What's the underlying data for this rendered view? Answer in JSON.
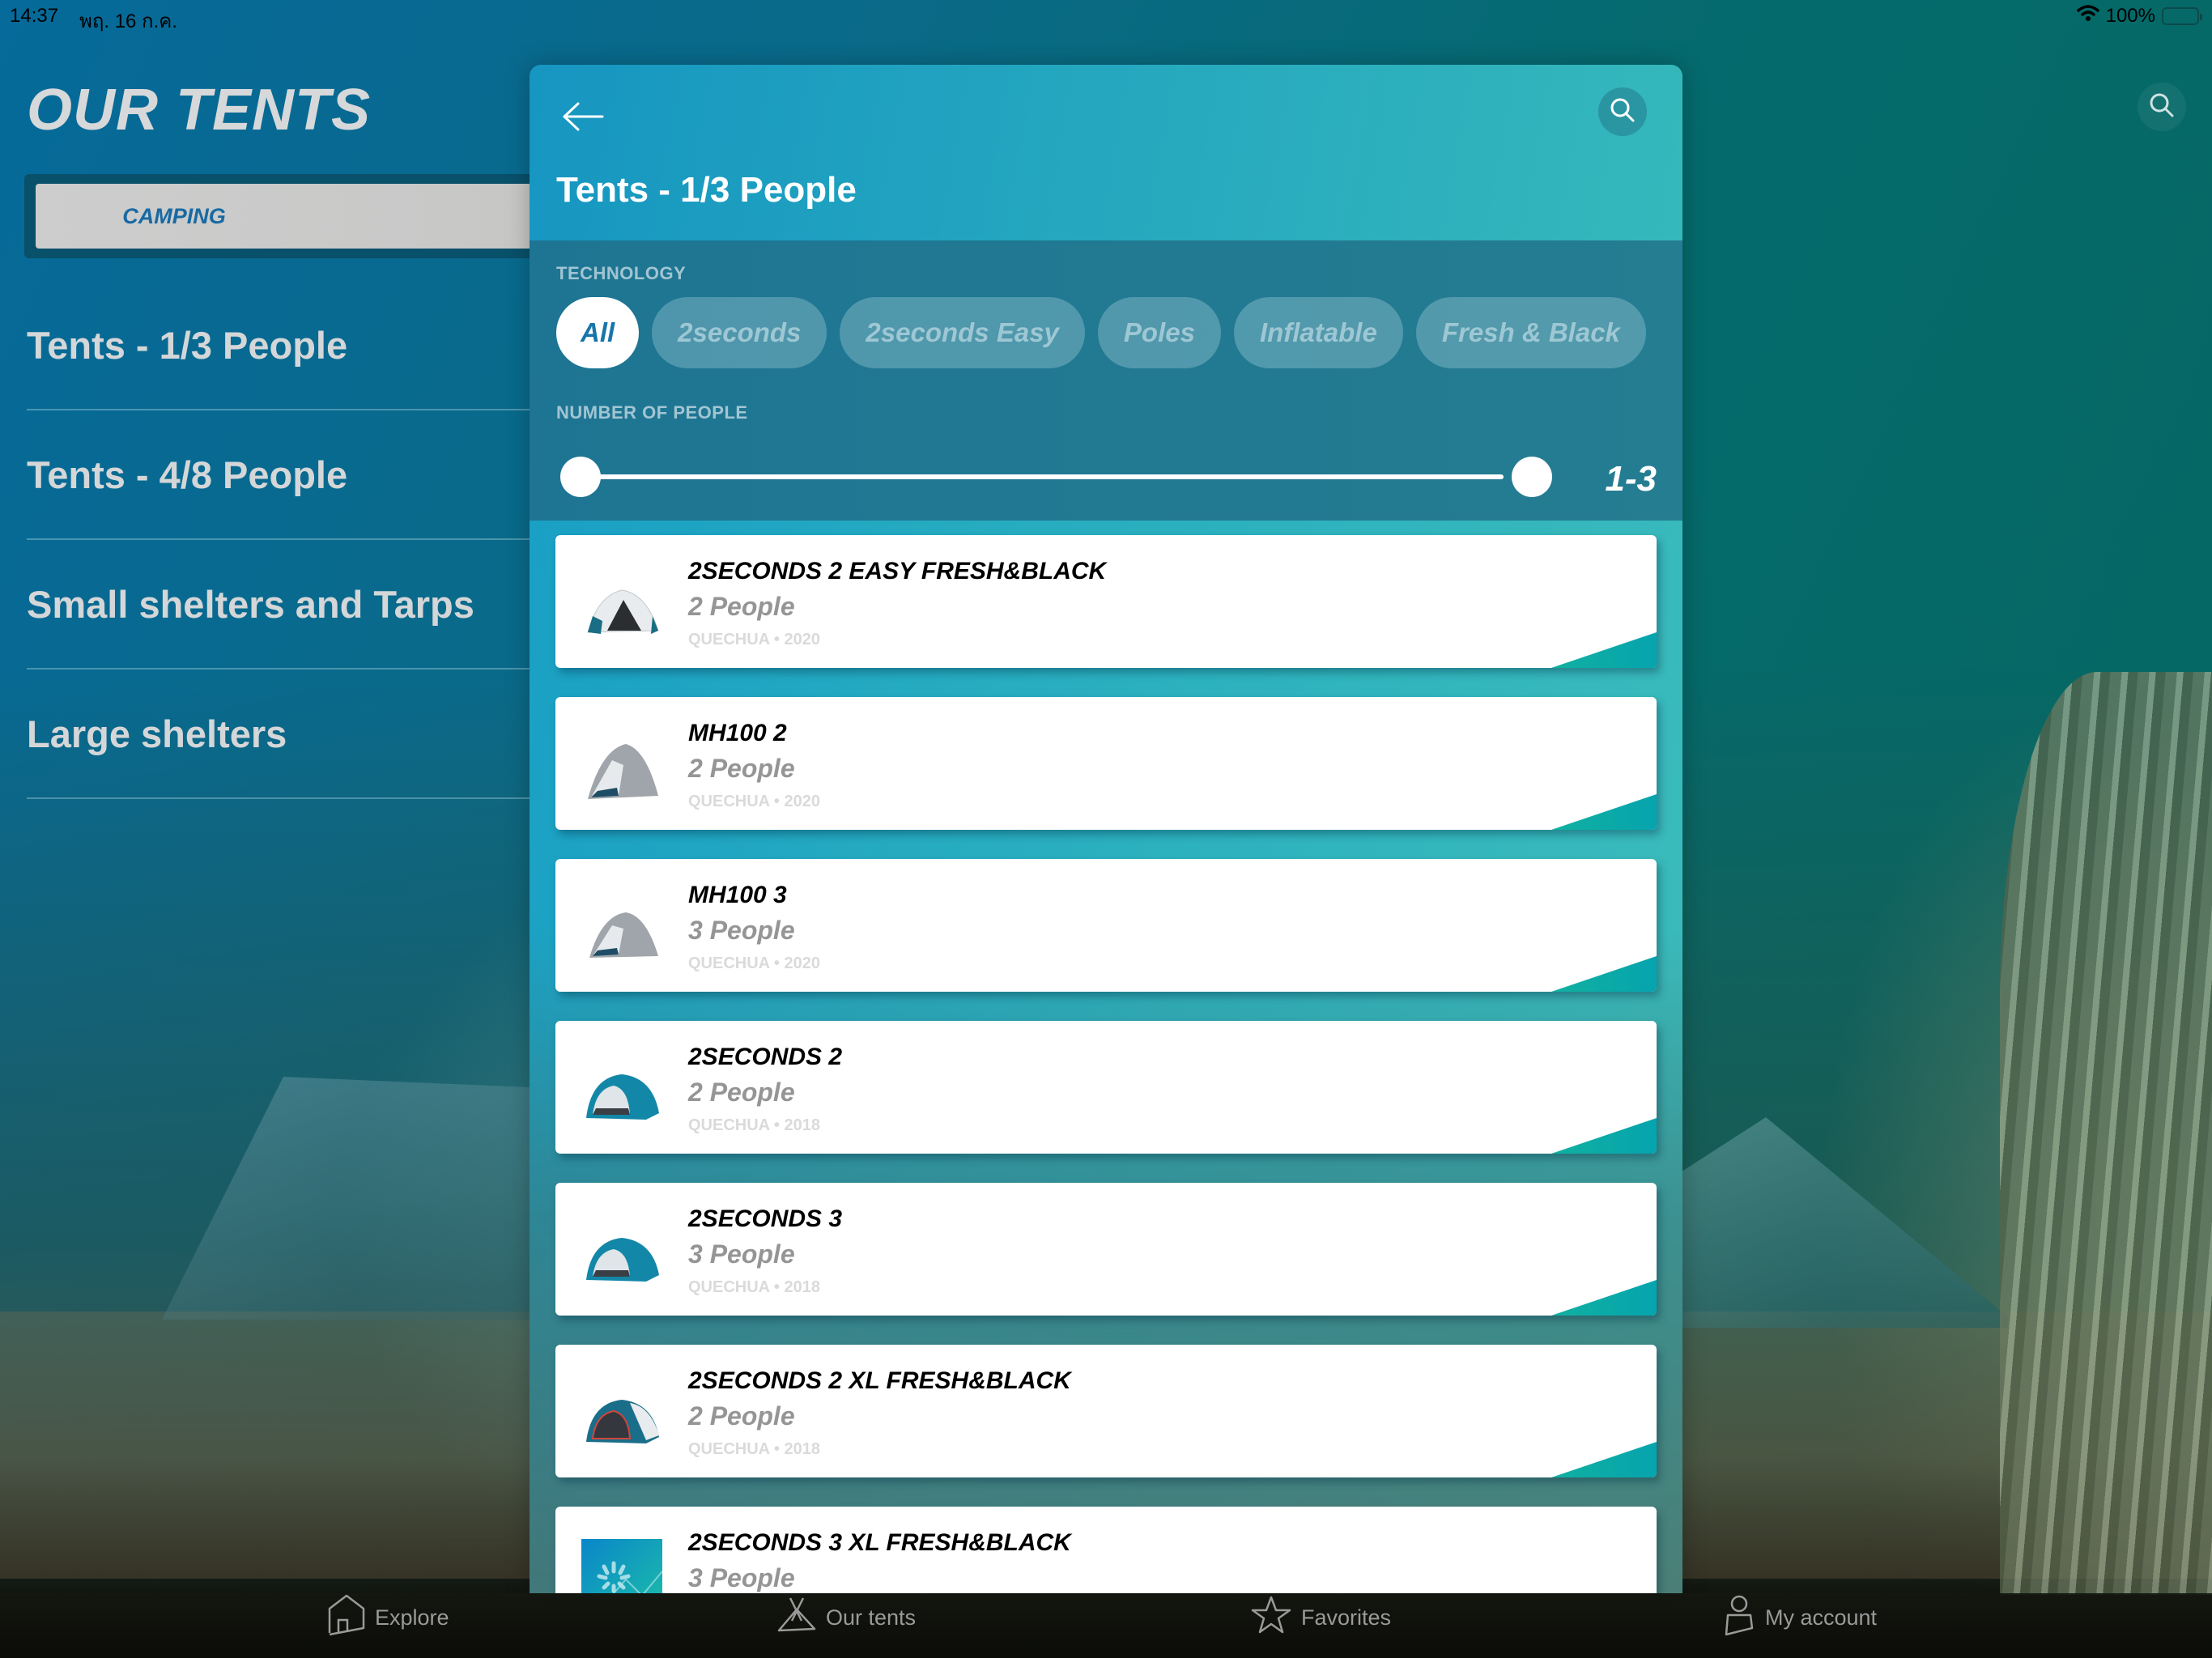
{
  "status_bar": {
    "time": "14:37",
    "date": "พฤ. 16 ก.ค.",
    "battery": "100%",
    "icons": [
      "wifi-icon",
      "battery-icon"
    ]
  },
  "sidebar": {
    "title": "OUR TENTS",
    "category_button": "CAMPING",
    "items": [
      {
        "label": "Tents - 1/3 People"
      },
      {
        "label": "Tents - 4/8 People"
      },
      {
        "label": "Small shelters and Tarps"
      },
      {
        "label": "Large shelters"
      }
    ]
  },
  "modal": {
    "title": "Tents - 1/3 People",
    "back_icon": "arrow-left-icon",
    "search_icon": "search-icon",
    "filters": {
      "technology_label": "TECHNOLOGY",
      "chips": [
        {
          "label": "All",
          "active": true
        },
        {
          "label": "2seconds",
          "active": false
        },
        {
          "label": "2seconds Easy",
          "active": false
        },
        {
          "label": "Poles",
          "active": false
        },
        {
          "label": "Inflatable",
          "active": false
        },
        {
          "label": "Fresh & Black",
          "active": false
        }
      ],
      "people_label": "NUMBER OF PEOPLE",
      "people_range": {
        "min": 1,
        "max": 3,
        "display": "1-3"
      }
    },
    "products": [
      {
        "name": "2SECONDS 2 EASY FRESH&BLACK",
        "people": "2 People",
        "meta": "QUECHUA • 2020",
        "thumb": "tent-white-dome"
      },
      {
        "name": "MH100 2",
        "people": "2 People",
        "meta": "QUECHUA • 2020",
        "thumb": "tent-grey-dome"
      },
      {
        "name": "MH100 3",
        "people": "3 People",
        "meta": "QUECHUA • 2020",
        "thumb": "tent-grey-dome"
      },
      {
        "name": "2SECONDS 2",
        "people": "2 People",
        "meta": "QUECHUA • 2018",
        "thumb": "tent-blue-popup"
      },
      {
        "name": "2SECONDS 3",
        "people": "3 People",
        "meta": "QUECHUA • 2018",
        "thumb": "tent-blue-popup"
      },
      {
        "name": "2SECONDS 2 XL FRESH&BLACK",
        "people": "2 People",
        "meta": "QUECHUA • 2018",
        "thumb": "tent-blue-dark-popup"
      },
      {
        "name": "2SECONDS 3 XL FRESH&BLACK",
        "people": "3 People",
        "meta": "",
        "thumb": "image-loading"
      }
    ]
  },
  "tab_bar": {
    "tabs": [
      {
        "label": "Explore",
        "icon": "home-icon"
      },
      {
        "label": "Our tents",
        "icon": "tent-icon"
      },
      {
        "label": "Favorites",
        "icon": "star-icon"
      },
      {
        "label": "My account",
        "icon": "user-icon"
      }
    ]
  },
  "colors": {
    "accent": "#1775ab",
    "header_gradient_start": "#1696c1",
    "header_gradient_end": "#35b8bb",
    "card_corner": "#11b0a0"
  }
}
